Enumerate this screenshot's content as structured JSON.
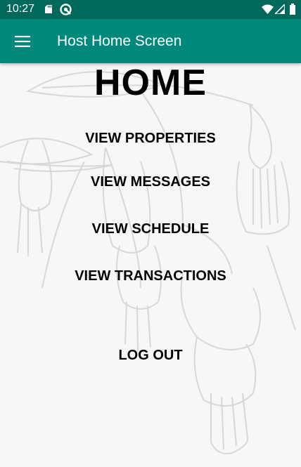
{
  "status_bar": {
    "time": "10:27",
    "icons": [
      "sd-card-icon",
      "sync-icon",
      "wifi-icon",
      "signal-icon",
      "battery-icon"
    ]
  },
  "app_bar": {
    "title": "Host Home Screen",
    "menu_icon": "hamburger-menu-icon"
  },
  "main": {
    "heading": "HOME",
    "buttons": [
      {
        "label": "VIEW PROPERTIES"
      },
      {
        "label": "VIEW MESSAGES"
      },
      {
        "label": "VIEW SCHEDULE"
      },
      {
        "label": "VIEW TRANSACTIONS"
      },
      {
        "label": "LOG OUT"
      }
    ]
  },
  "colors": {
    "status_bar": "#00695c",
    "app_bar": "#00897b",
    "background": "#f7f7f7",
    "text": "#000000"
  }
}
